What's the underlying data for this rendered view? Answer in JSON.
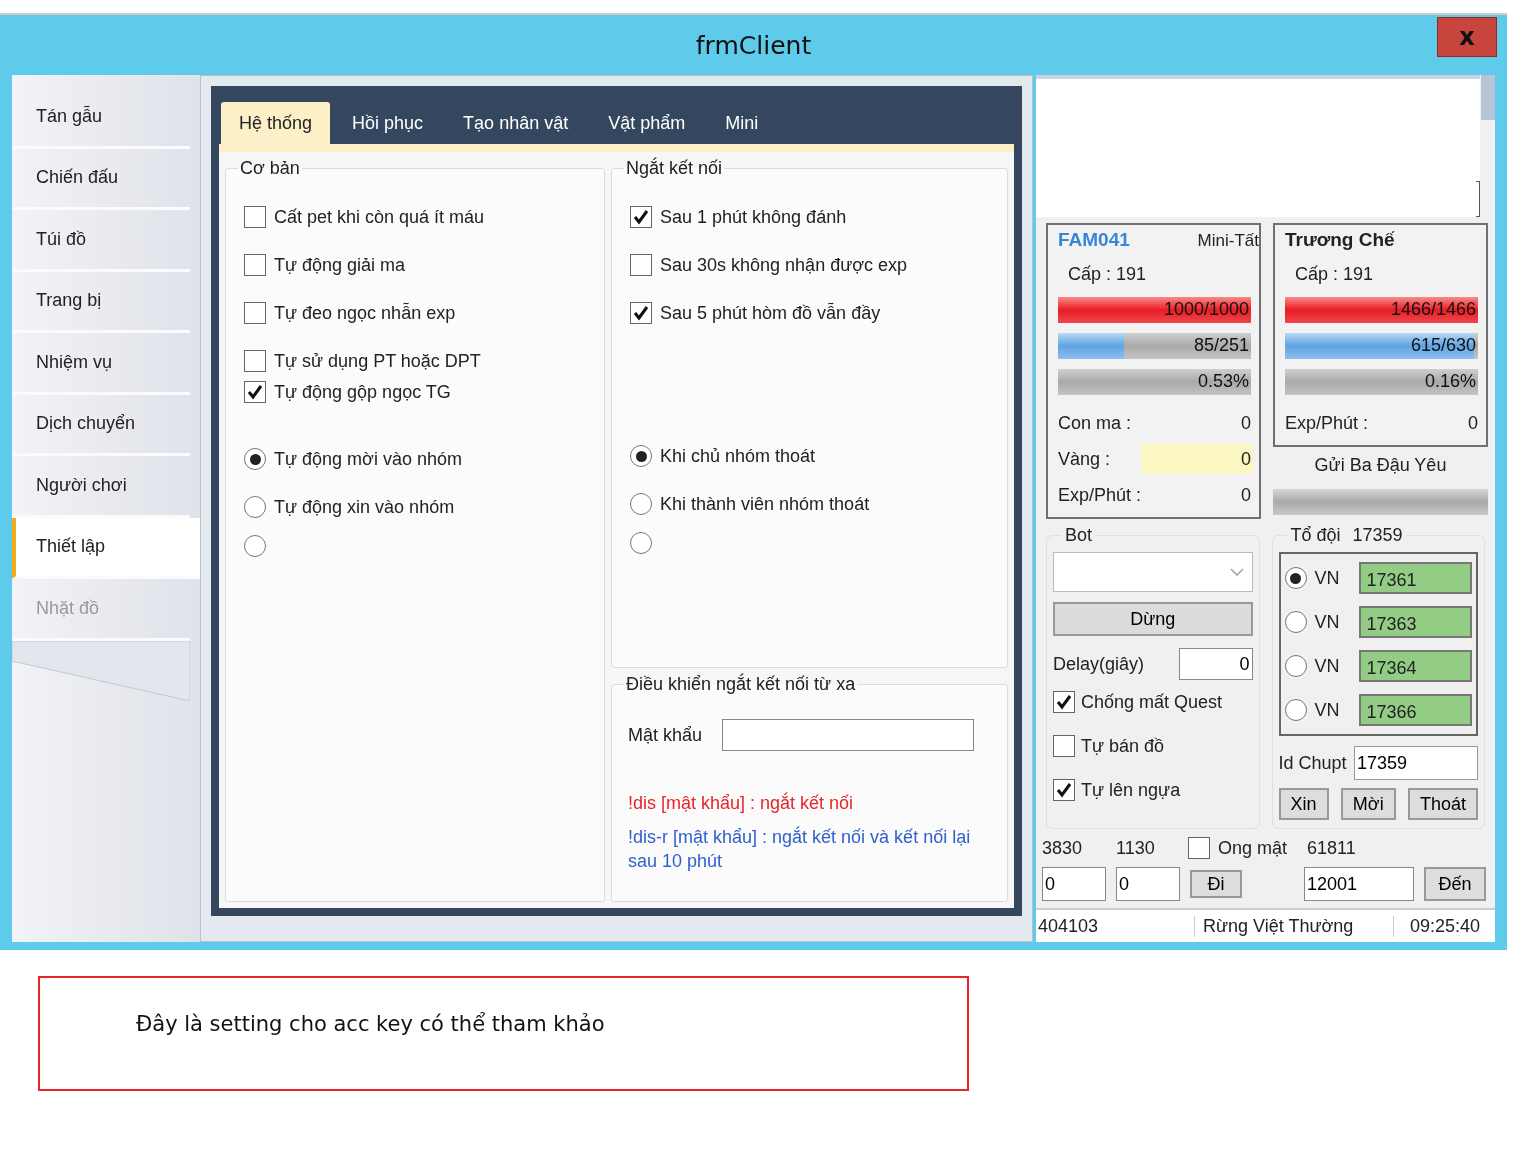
{
  "window": {
    "title": "frmClient",
    "close": "x"
  },
  "sidebar": {
    "items": [
      {
        "label": "Tán gẫu",
        "selected": false,
        "disabled": false
      },
      {
        "label": "Chiến đấu",
        "selected": false,
        "disabled": false
      },
      {
        "label": "Túi đồ",
        "selected": false,
        "disabled": false
      },
      {
        "label": "Trang bị",
        "selected": false,
        "disabled": false
      },
      {
        "label": "Nhiệm vụ",
        "selected": false,
        "disabled": false
      },
      {
        "label": "Dịch chuyển",
        "selected": false,
        "disabled": false
      },
      {
        "label": "Người chơi",
        "selected": false,
        "disabled": false
      },
      {
        "label": "Thiết lập",
        "selected": true,
        "disabled": false
      },
      {
        "label": "Nhặt đồ",
        "selected": false,
        "disabled": true
      }
    ]
  },
  "tabs": [
    {
      "label": "Hệ thống",
      "selected": true
    },
    {
      "label": "Hồi phục",
      "selected": false
    },
    {
      "label": "Tạo nhân vật",
      "selected": false
    },
    {
      "label": "Vật phẩm",
      "selected": false
    },
    {
      "label": "Mini",
      "selected": false
    }
  ],
  "basic": {
    "title": "Cơ bản",
    "checkboxes": [
      {
        "label": "Cất pet khi còn quá ít máu",
        "checked": false
      },
      {
        "label": "Tự động giải ma",
        "checked": false
      },
      {
        "label": "Tự đeo ngọc nhẫn exp",
        "checked": false
      },
      {
        "label": "Tự sử dụng PT hoặc DPT",
        "checked": false
      },
      {
        "label": "Tự động gộp ngọc TG",
        "checked": true
      }
    ],
    "radios": [
      {
        "label": "Tự động mời vào nhóm",
        "selected": true
      },
      {
        "label": "Tự động xin vào nhóm",
        "selected": false
      },
      {
        "selected": false
      }
    ]
  },
  "disconnect": {
    "title": "Ngắt kết nối",
    "checkboxes": [
      {
        "label": "Sau 1 phút không đánh",
        "checked": true
      },
      {
        "label": "Sau 30s không nhận được exp",
        "checked": false
      },
      {
        "label": "Sau 5 phút hòm đồ vẫn đầy",
        "checked": true
      }
    ],
    "radios": [
      {
        "label": "Khi chủ nhóm thoát",
        "selected": true
      },
      {
        "label": "Khi thành viên nhóm thoát",
        "selected": false
      },
      {
        "selected": false
      }
    ]
  },
  "remote": {
    "title": "Điều khiển ngắt kết nối từ xa",
    "password_label": "Mật khẩu",
    "notes": [
      {
        "kind": "error",
        "text": "!dis [mật khẩu] : ngắt kết nối"
      },
      {
        "kind": "info",
        "text": "!dis-r [mật khẩu] : ngắt kết nối và kết nối lại sau 10 phút"
      }
    ]
  },
  "characters": [
    {
      "name": "FAM041",
      "tag": "Mini-Tất",
      "level_text": "Cấp : 191",
      "bars": [
        {
          "kind": "hp",
          "level": 1,
          "text": "1000/1000"
        },
        {
          "kind": "mp",
          "level": 0.34,
          "text": "85/251"
        },
        {
          "kind": "exp",
          "text": "0.53%"
        }
      ],
      "stats": [
        {
          "label": "Con ma :",
          "value": "0",
          "highlight": false
        },
        {
          "label": "Vàng :",
          "value": "0",
          "highlight": true
        },
        {
          "label": "Exp/Phút :",
          "value": "0",
          "highlight": false
        }
      ]
    },
    {
      "name": "Trương Chế",
      "level_text": "Cấp : 191",
      "bars": [
        {
          "kind": "hp",
          "level": 1,
          "text": "1466/1466"
        },
        {
          "kind": "mp",
          "level": 0.98,
          "text": "615/630"
        },
        {
          "kind": "exp",
          "text": "0.16%"
        }
      ],
      "stats": [
        {
          "label": "Exp/Phút :",
          "value": "0",
          "highlight": false
        }
      ]
    }
  ],
  "gift_label": "Gửi Ba Đậu Yêu",
  "gift_bar": {
    "level": 0
  },
  "bot": {
    "title": "Bot",
    "button": "Dừng",
    "delay_label": "Delay(giây)",
    "delay_value": "0",
    "checkboxes": [
      {
        "label": "Chống mất Quest",
        "checked": true
      },
      {
        "label": "Tự bán đồ",
        "checked": false
      },
      {
        "label": "Tự lên ngựa",
        "checked": true
      }
    ]
  },
  "team": {
    "title": "Tổ đội",
    "team_id": "17359",
    "members": [
      {
        "server": "VN",
        "id": "17361",
        "selected": true
      },
      {
        "server": "VN",
        "id": "17363",
        "selected": false
      },
      {
        "server": "VN",
        "id": "17364",
        "selected": false
      },
      {
        "server": "VN",
        "id": "17366",
        "selected": false
      }
    ],
    "id_label": "Id Chupt",
    "id_value": "17359",
    "buttons": [
      "Xin",
      "Mời",
      "Thoát"
    ]
  },
  "coords": {
    "x_label": "3830",
    "y_label": "1130",
    "x_value": "0",
    "y_value": "0",
    "go_button": "Đi",
    "bee_label": "Ong mật",
    "bee_checked": false,
    "map_label": "61811",
    "map_value": "12001",
    "to_button": "Đến"
  },
  "status_bar": [
    "404103",
    "Rừng Việt Thường",
    "09:25:40"
  ],
  "caption": "Đây là setting cho acc key có thể tham khảo"
}
